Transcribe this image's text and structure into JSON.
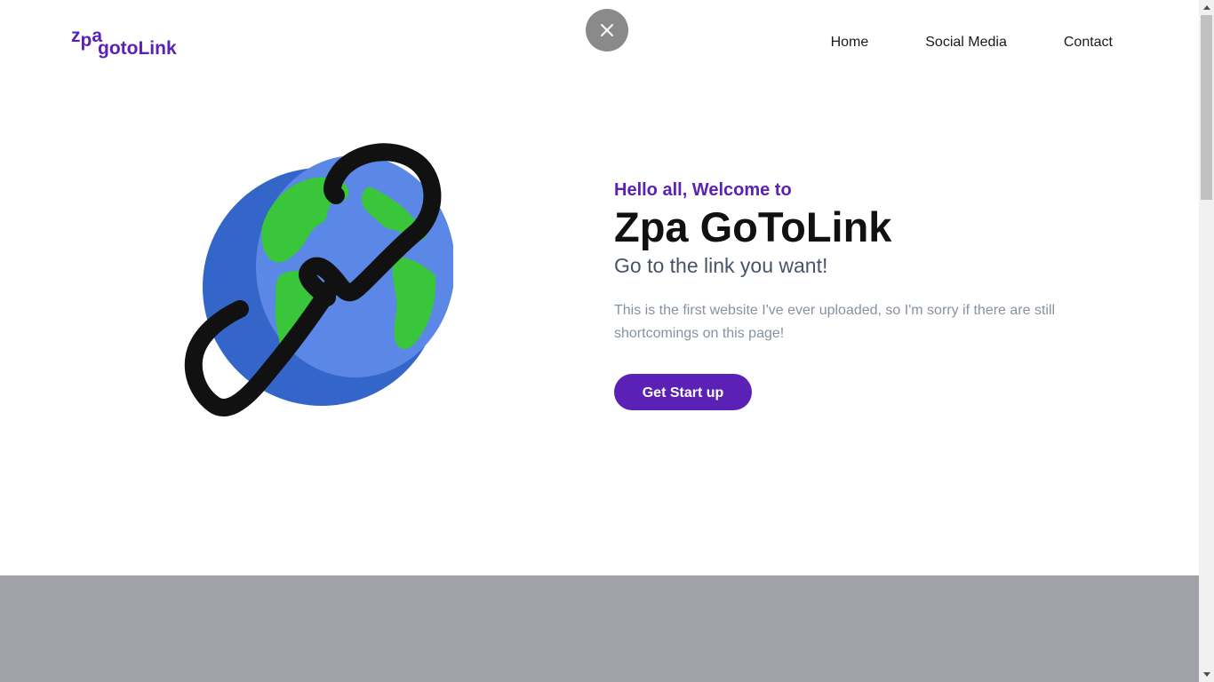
{
  "header": {
    "logo": {
      "top_text": "zpa",
      "bottom_text": "gotoLink"
    },
    "close_icon": "close-icon",
    "nav": [
      {
        "label": "Home"
      },
      {
        "label": "Social Media"
      },
      {
        "label": "Contact"
      }
    ]
  },
  "hero": {
    "illustration_icon": "globe-chain-link-icon",
    "greeting": "Hello all, Welcome to",
    "title": "Zpa GoToLink",
    "subtitle": "Go to the link you want!",
    "description": "This is the first website I've ever uploaded, so I'm sorry if there are still shortcomings on this page!",
    "cta_label": "Get Start up"
  },
  "colors": {
    "brand": "#5b21b6",
    "footer_band": "#a1a1aa",
    "close_button": "#8a8a8a"
  }
}
